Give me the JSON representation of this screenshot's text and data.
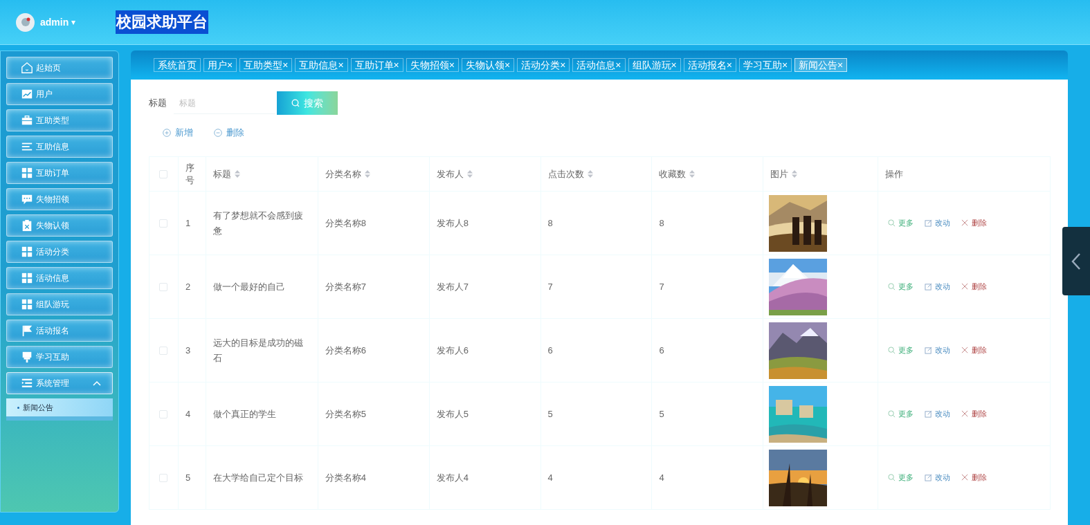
{
  "header": {
    "user": "admin",
    "caret": "▾",
    "title": "校园求助平台"
  },
  "sidebar": {
    "items": [
      {
        "label": "起始页"
      },
      {
        "label": "用户"
      },
      {
        "label": "互助类型"
      },
      {
        "label": "互助信息"
      },
      {
        "label": "互助订单"
      },
      {
        "label": "失物招领"
      },
      {
        "label": "失物认领"
      },
      {
        "label": "活动分类"
      },
      {
        "label": "活动信息"
      },
      {
        "label": "组队游玩"
      },
      {
        "label": "活动报名"
      },
      {
        "label": "学习互助"
      },
      {
        "label": "系统管理",
        "expanded": true,
        "children": [
          {
            "label": "新闻公告",
            "selected": true
          }
        ]
      }
    ]
  },
  "tabs": [
    {
      "label": "系统首页",
      "selected": false
    },
    {
      "label": "用户",
      "close": "×",
      "selected": false
    },
    {
      "label": "互助类型",
      "close": "×",
      "selected": false
    },
    {
      "label": "互助信息",
      "close": "×",
      "selected": false
    },
    {
      "label": "互助订单",
      "close": "×",
      "selected": false
    },
    {
      "label": "失物招领",
      "close": "×",
      "selected": false
    },
    {
      "label": "失物认领",
      "close": "×",
      "selected": false
    },
    {
      "label": "活动分类",
      "close": "×",
      "selected": false
    },
    {
      "label": "活动信息",
      "close": "×",
      "selected": false
    },
    {
      "label": "组队游玩",
      "close": "×",
      "selected": false
    },
    {
      "label": "活动报名",
      "close": "×",
      "selected": false
    },
    {
      "label": "学习互助",
      "close": "×",
      "selected": false
    },
    {
      "label": "新闻公告",
      "close": "×",
      "selected": true
    }
  ],
  "search": {
    "label": "标题",
    "placeholder": "标题",
    "button": "搜索"
  },
  "actions": [
    "新增",
    "删除"
  ],
  "table": {
    "header_checked": false,
    "columns": [
      {
        "label": "序号",
        "sortable": false
      },
      {
        "label": "标题",
        "sortable": true
      },
      {
        "label": "分类名称",
        "sortable": true
      },
      {
        "label": "发布人",
        "sortable": true
      },
      {
        "label": "点击次数",
        "sortable": true
      },
      {
        "label": "收藏数",
        "sortable": true
      },
      {
        "label": "图片",
        "sortable": true
      },
      {
        "label": "操作",
        "sortable": false
      }
    ],
    "rows": [
      {
        "checked": false,
        "cells": [
          "1",
          "有了梦想就不会感到疲惫",
          "分类名称8",
          "发布人8",
          "8",
          "8"
        ],
        "actions": [
          "更多",
          "改动",
          "删除"
        ]
      },
      {
        "checked": false,
        "cells": [
          "2",
          "做一个最好的自己",
          "分类名称7",
          "发布人7",
          "7",
          "7"
        ],
        "actions": [
          "更多",
          "改动",
          "删除"
        ]
      },
      {
        "checked": false,
        "cells": [
          "3",
          "远大的目标是成功的磁石",
          "分类名称6",
          "发布人6",
          "6",
          "6"
        ],
        "actions": [
          "更多",
          "改动",
          "删除"
        ]
      },
      {
        "checked": false,
        "cells": [
          "4",
          "做个真正的学生",
          "分类名称5",
          "发布人5",
          "5",
          "5"
        ],
        "actions": [
          "更多",
          "改动",
          "删除"
        ]
      },
      {
        "checked": false,
        "cells": [
          "5",
          "在大学给自己定个目标",
          "分类名称4",
          "发布人4",
          "4",
          "4"
        ],
        "actions": [
          "更多",
          "改动",
          "删除"
        ]
      }
    ]
  }
}
